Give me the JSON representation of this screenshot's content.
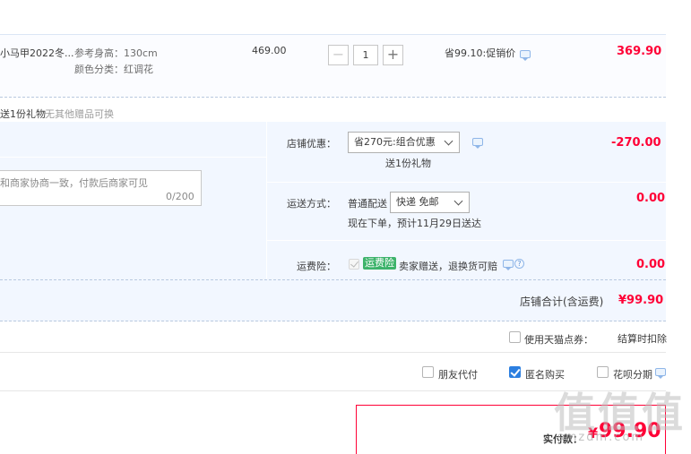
{
  "item": {
    "title": "小马甲2022冬...",
    "sku_height": "参考身高：130cm",
    "sku_color": "颜色分类：红调花",
    "unit_price": "469.00",
    "quantity": "1",
    "minus_label": "−",
    "plus_label": "+",
    "discount": "省99.10:促销价",
    "total": "369.90"
  },
  "gift": {
    "label": "送1份礼物",
    "note": "无其他赠品可换"
  },
  "message": {
    "placeholder": "和商家协商一致，付款后商家可见",
    "counter": "0/200"
  },
  "shop_discount": {
    "label": "店铺优惠：",
    "selected": "省270元:组合优惠",
    "gift": "送1份礼物",
    "amount": "-270.00"
  },
  "shipping": {
    "label": "运送方式：",
    "type": "普通配送",
    "selected": "快递 免邮",
    "eta": "现在下单，预计11月29日送达",
    "amount": "0.00"
  },
  "insurance": {
    "label": "运费险：",
    "badge": "运费险",
    "desc": "卖家赠送，退换货可赔",
    "help": "?",
    "amount": "0.00"
  },
  "subtotal": {
    "label": "店铺合计(含运费)",
    "amount": "¥99.90"
  },
  "tmall_points": {
    "label": "使用天猫点券：",
    "note": "结算时扣除"
  },
  "options": {
    "friend_pay": "朋友代付",
    "anonymous": "匿名购买",
    "huabei": "花呗分期"
  },
  "payment": {
    "label": "实付款：",
    "currency": "¥",
    "amount": "99.90"
  },
  "watermark": {
    "main": "值值值",
    "sub": "smzdm.com"
  },
  "colors": {
    "price_red": "#ff0036",
    "panel_bg": "#f2f7ff",
    "checkbox_blue": "#2c7fe0",
    "insurance_green": "#3db36b"
  },
  "icons": [
    "chat-icon",
    "question-icon",
    "checkmark-icon",
    "chevron-down-icon"
  ]
}
